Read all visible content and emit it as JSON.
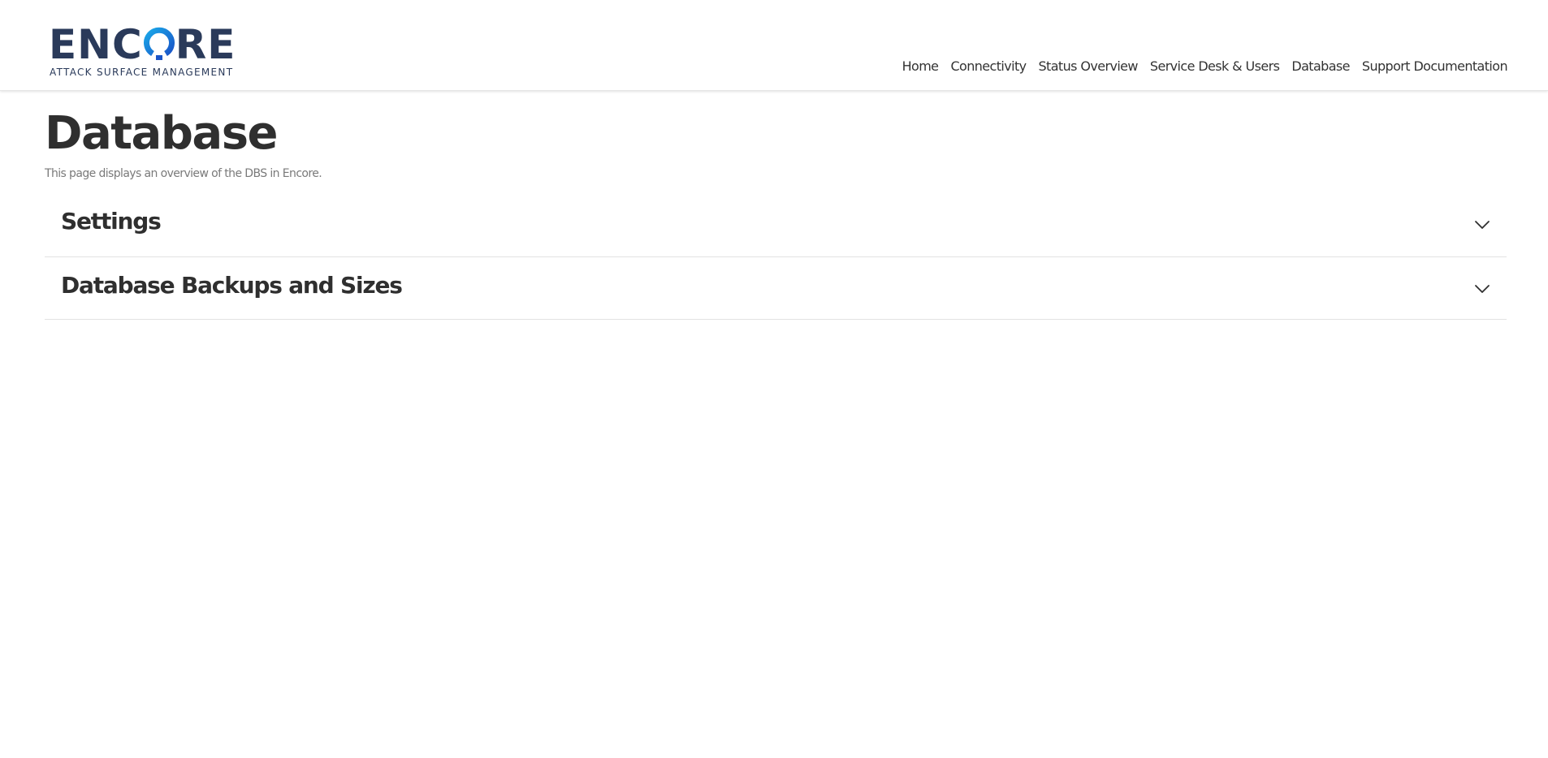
{
  "brand": {
    "name_prefix": "ENC",
    "name_suffix": "RE",
    "tagline": "ATTACK SURFACE MANAGEMENT",
    "primary_color": "#2a3a5a",
    "accent_color": "#1e9ee0"
  },
  "nav": {
    "items": [
      {
        "label": "Home"
      },
      {
        "label": "Connectivity"
      },
      {
        "label": "Status Overview"
      },
      {
        "label": "Service Desk & Users"
      },
      {
        "label": "Database"
      },
      {
        "label": "Support Documentation"
      }
    ]
  },
  "page": {
    "title": "Database",
    "description": "This page displays an overview of the DBS in Encore."
  },
  "accordion": {
    "sections": [
      {
        "title": "Settings",
        "icon": "chevron-down-icon"
      },
      {
        "title": "Database Backups and Sizes",
        "icon": "chevron-down-icon"
      }
    ]
  }
}
